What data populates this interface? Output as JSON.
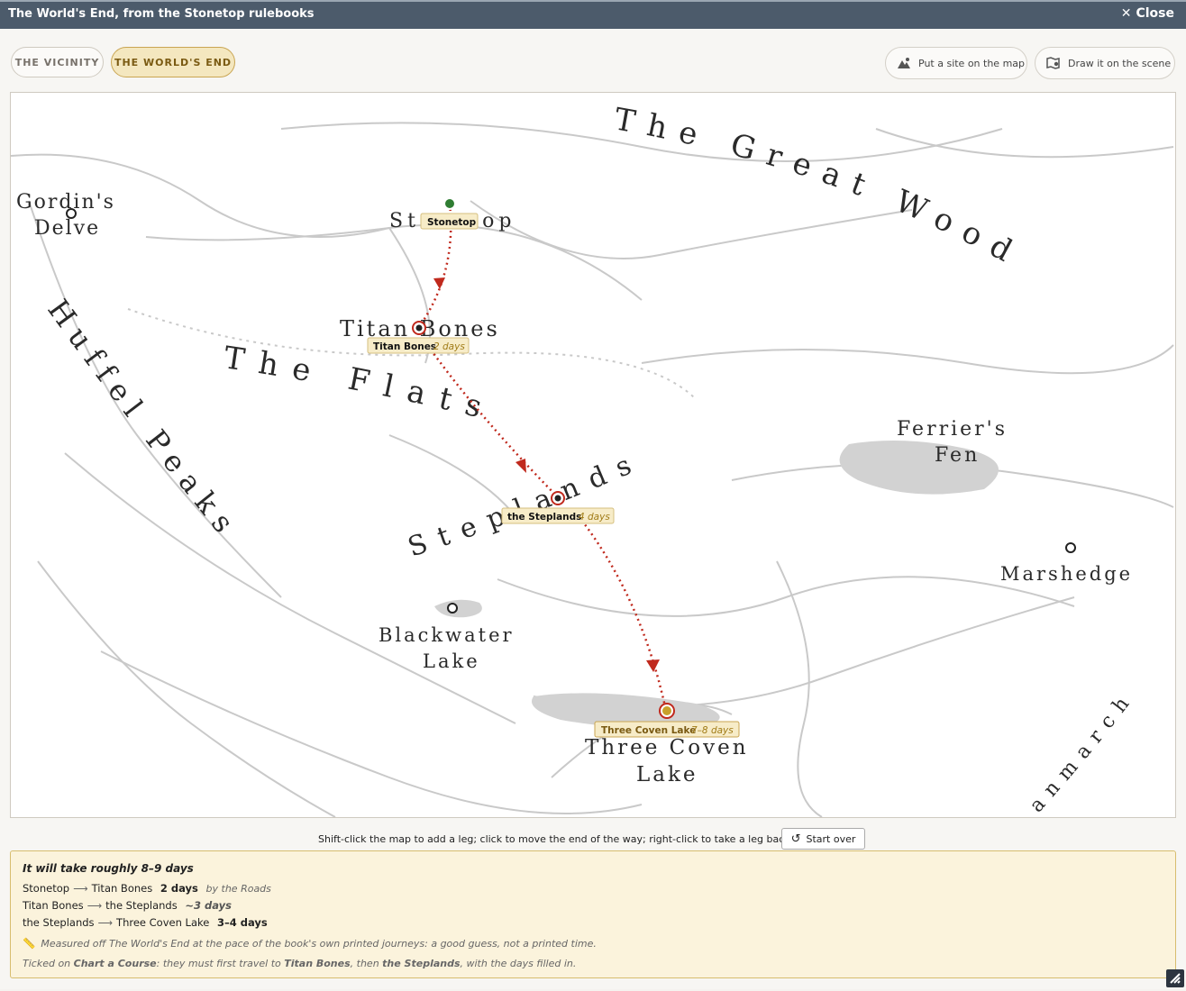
{
  "window": {
    "title": "The World's End, from the Stonetop rulebooks",
    "close_label": "Close"
  },
  "tabs": [
    {
      "label": "THE VICINITY",
      "active": false
    },
    {
      "label": "THE WORLD'S END",
      "active": true
    }
  ],
  "toolbar": {
    "put_site_label": "Put a site on the map",
    "draw_scene_label": "Draw it on the scene"
  },
  "map": {
    "labels": {
      "great_wood": "The Great Wood",
      "gordins_delve_1": "Gordin's",
      "gordins_delve_2": "Delve",
      "stonetop": "Stonetop",
      "titan_bones": "Titan Bones",
      "huffel_peaks": "Huffel Peaks",
      "the_flats": "The Flats",
      "steplands": "Steplands",
      "ferriers_fen_1": "Ferrier's",
      "ferriers_fen_2": "Fen",
      "marshedge": "Marshedge",
      "blackwater_1": "Blackwater",
      "blackwater_2": "Lake",
      "three_coven_1": "Three Coven",
      "three_coven_2": "Lake",
      "anmarch": "anmarch"
    },
    "route_stops": [
      {
        "name": "Stonetop",
        "days": ""
      },
      {
        "name": "Titan Bones",
        "days": "2 days"
      },
      {
        "name": "the Steplands",
        "days": "4 days"
      },
      {
        "name": "Three Coven Lake",
        "days": "7–8 days"
      }
    ],
    "colors": {
      "route": "#c0291d",
      "start_marker": "#2f7d32",
      "end_marker": "#c8a12c"
    }
  },
  "hint": {
    "text": "Shift-click the map to add a leg; click to move the end of the way; right-click to take a leg back.",
    "start_over_label": "Start over"
  },
  "summary": {
    "headline": "It will take roughly 8–9 days",
    "legs": [
      {
        "from": "Stonetop",
        "to": "Titan Bones",
        "days": "2 days",
        "note": "by the Roads"
      },
      {
        "from": "Titan Bones",
        "to": "the Steplands",
        "days": "~3 days",
        "note": ""
      },
      {
        "from": "the Steplands",
        "to": "Three Coven Lake",
        "days": "3–4 days",
        "note": ""
      }
    ],
    "measured_note": "Measured off The World's End at the pace of the book's own printed journeys: a good guess, not a printed time.",
    "ticked": {
      "prefix": "Ticked on ",
      "move": "Chart a Course",
      "middle": ": they must first travel to ",
      "stop1": "Titan Bones",
      "then": ", then ",
      "stop2": "the Steplands",
      "suffix": ", with the days filled in."
    }
  }
}
